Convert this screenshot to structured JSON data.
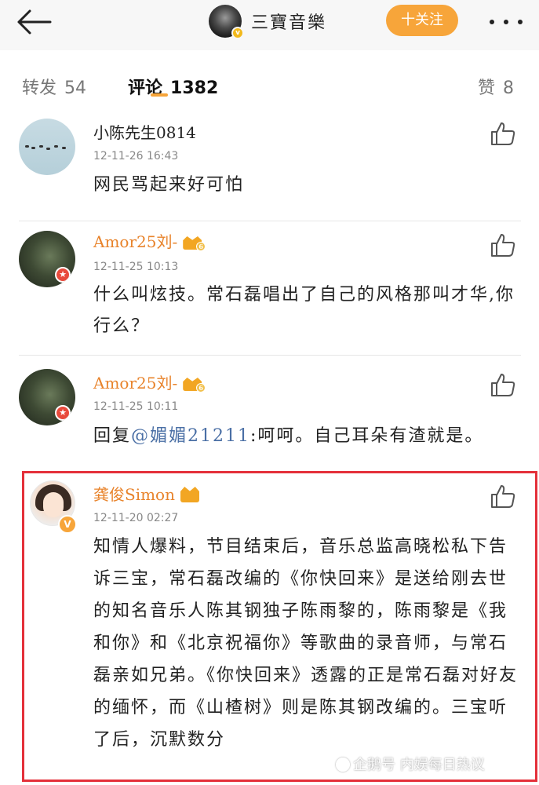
{
  "header": {
    "account_name": "三寶音樂",
    "follow_label": "十关注"
  },
  "tabs": [
    {
      "label": "转发",
      "count": "54"
    },
    {
      "label": "评论",
      "count": "1382"
    },
    {
      "label": "赞",
      "count": "8"
    }
  ],
  "comments": [
    {
      "user": "小陈先生0814",
      "time": "12-11-26 16:43",
      "text": "网民骂起来好可怕"
    },
    {
      "user": "Amor25刘-",
      "time": "12-11-25 10:13",
      "text": "什么叫炫技。常石磊唱出了自己的风格那叫才华,你行么？"
    },
    {
      "user": "Amor25刘-",
      "time": "12-11-25 10:11",
      "reply_prefix": "回复",
      "mention": "@媚媚21211",
      "text": ":呵呵。自己耳朵有渣就是。"
    },
    {
      "user": "龚俊Simon",
      "time": "12-11-20 02:27",
      "text": "知情人爆料，节目结束后，音乐总监高晓松私下告诉三宝，常石磊改编的《你快回来》是送给刚去世的知名音乐人陈其钢独子陈雨黎的，陈雨黎是《我和你》和《北京祝福你》等歌曲的录音师，与常石磊亲如兄弟。《你快回来》透露的正是常石磊对好友的缅怀，而《山楂树》则是陈其钢改编的。三宝听了后，沉默数分"
    }
  ],
  "watermark": "企鹅号 内娱每日热议",
  "colors": {
    "accent": "#f7a53a",
    "vip_name": "#e8832b",
    "mention": "#4a6fa5",
    "highlight_border": "#e4303a"
  }
}
